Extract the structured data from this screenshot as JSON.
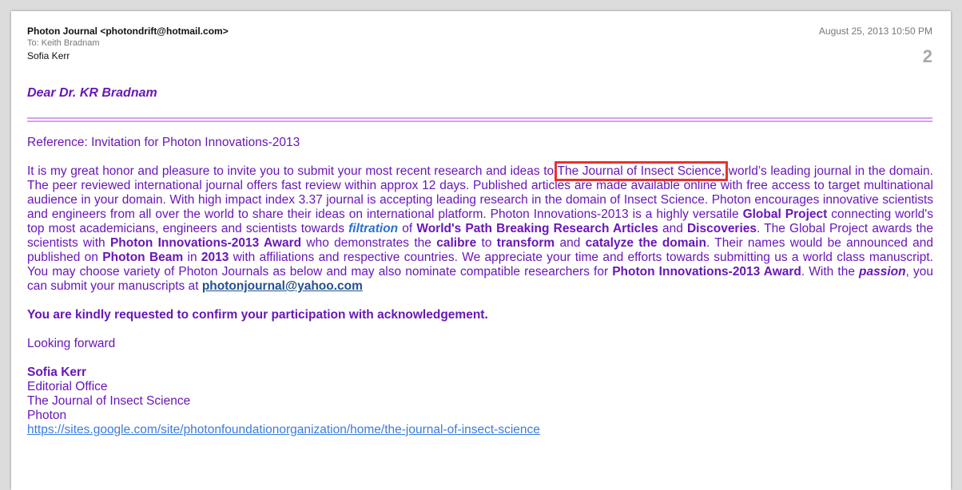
{
  "header": {
    "from": "Photon Journal <photondrift@hotmail.com>",
    "to": "To:  Keith Bradnam",
    "cc": "Sofia Kerr",
    "date": "August 25, 2013  10:50 PM",
    "page_number": "2"
  },
  "greeting": "Dear Dr. KR Bradnam",
  "reference": "Reference: Invitation for Photon Innovations-2013",
  "paragraph": {
    "t1": "It is my great honor and pleasure to invite you to submit your most recent research and ideas to ",
    "journal": "The Journal of Insect Science,",
    "t2": " world’s leading journal in the domain. The peer reviewed international journal offers fast review within approx 12 days. Published articles are made available online with free access to target multinational audience in your domain. With high impact index 3.37 journal is accepting leading research in the domain of Insect Science. Photon encourages innovative scientists and engineers from all over the world to share their ideas on international platform. Photon Innovations-2013 is a highly versatile ",
    "b1": "Global Project",
    "t3": " connecting world's top most academicians, engineers and scientists towards ",
    "filtration": "filtration",
    "t4": " of ",
    "b2": "World's Path Breaking Research Articles",
    "t5": " and ",
    "b3": "Discoveries",
    "t6": ". The Global Project awards the scientists with ",
    "b4": "Photon Innovations-2013 Award",
    "t7": " who demonstrates the ",
    "b5": "calibre",
    "t8": " to ",
    "b6": "transform",
    "t9": " and ",
    "b7": "catalyze the domain",
    "t10": ". Their names would be announced and published on ",
    "b8": "Photon Beam",
    "t11": " in ",
    "b9": "2013",
    "t12": " with affiliations and respective countries. We appreciate your time and efforts towards submitting us a world class manuscript. You may choose variety of Photon Journals as below and may also nominate compatible researchers for ",
    "b10": "Photon Innovations-2013 Award",
    "t13": ". With the ",
    "passion": "passion",
    "t14": ", you can submit your manuscripts at ",
    "email": "photonjournal@yahoo.com"
  },
  "confirm": "You are kindly requested to confirm your participation with acknowledgement.",
  "closing": "Looking forward",
  "signature": {
    "name": "Sofia Kerr",
    "line1": "Editorial Office",
    "line2": "The Journal of Insect Science",
    "line3": "Photon",
    "url": "https://sites.google.com/site/photonfoundationorganization/home/the-journal-of-insect-science"
  },
  "colors": {
    "body_text": "#6a16b8",
    "highlight_box": "#e8322d",
    "link": "#3a7be0",
    "rule": "#d6a0ee"
  }
}
